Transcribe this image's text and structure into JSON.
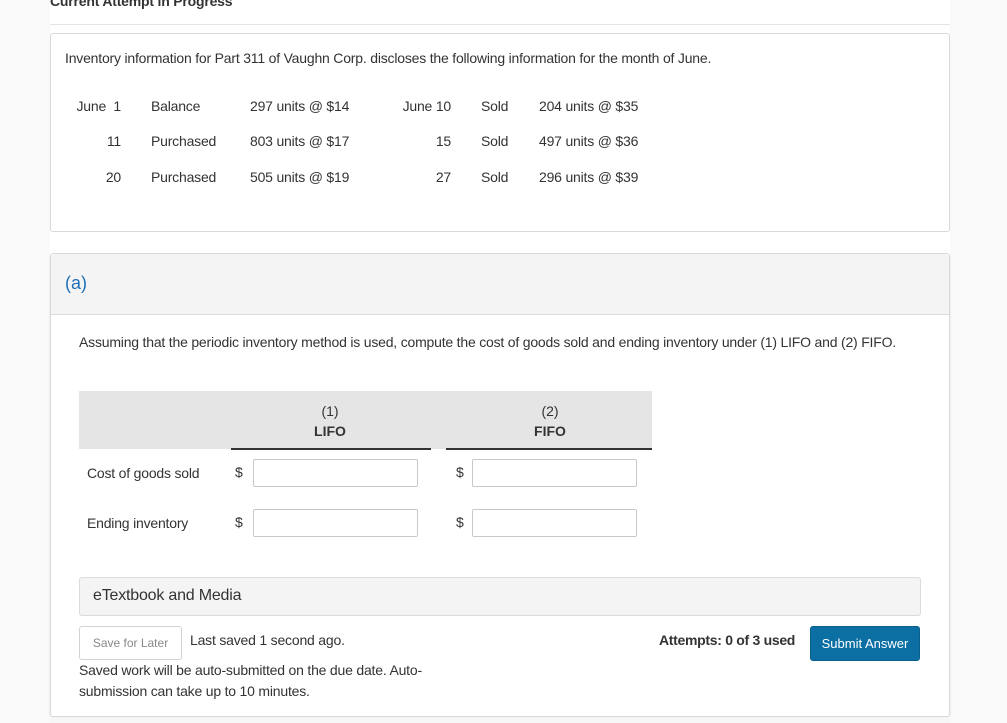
{
  "page": {
    "attempt_header": "Current Attempt in Progress"
  },
  "problem": {
    "intro": "Inventory information for Part 311 of Vaughn Corp. discloses the following information for the month of June.",
    "rows": [
      {
        "date1": "June  1",
        "type1": "Balance",
        "qty1": "297 units @ $14",
        "date2": "June 10",
        "type2": "Sold",
        "qty2": "204 units @ $35"
      },
      {
        "date1": "11",
        "type1": "Purchased",
        "qty1": "803 units @ $17",
        "date2": "15",
        "type2": "Sold",
        "qty2": "497 units @ $36"
      },
      {
        "date1": "20",
        "type1": "Purchased",
        "qty1": "505 units @ $19",
        "date2": "27",
        "type2": "Sold",
        "qty2": "296 units @ $39"
      }
    ]
  },
  "part_a": {
    "label": "(a)",
    "question": "Assuming that the periodic inventory method is used, compute the cost of goods sold and ending inventory under (1) LIFO and (2) FIFO.",
    "columns": [
      {
        "number": "(1)",
        "name": "LIFO"
      },
      {
        "number": "(2)",
        "name": "FIFO"
      }
    ],
    "currency_symbol": "$",
    "rows": [
      {
        "label": "Cost of goods sold",
        "lifo_value": "",
        "fifo_value": ""
      },
      {
        "label": "Ending inventory",
        "lifo_value": "",
        "fifo_value": ""
      }
    ]
  },
  "footer": {
    "media_label": "eTextbook and Media",
    "save_label": "Save for Later",
    "last_saved": "Last saved 1 second ago.",
    "autosubmit_note": "Saved work will be auto-submitted on the due date. Auto-submission can take up to 10 minutes.",
    "attempts": "Attempts: 0 of 3 used",
    "submit_label": "Submit Answer"
  },
  "colors": {
    "accent": "#0b6fa4",
    "part_label": "#1f70b8"
  }
}
